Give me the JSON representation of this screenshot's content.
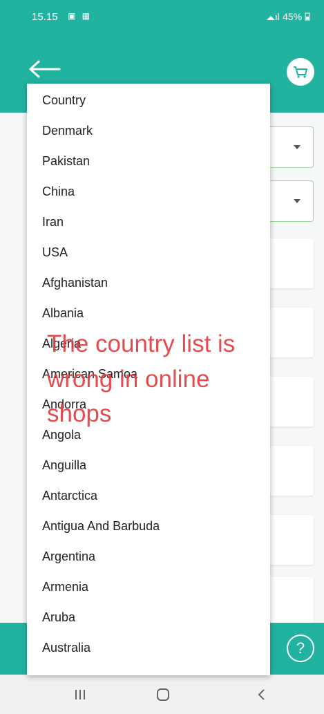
{
  "status_bar": {
    "time": "15.15",
    "notification_icons": "▣ ▦",
    "right": "45%"
  },
  "dropdown": {
    "items": [
      "Country",
      "Denmark",
      "Pakistan",
      "China",
      "Iran",
      "USA",
      "Afghanistan",
      "Albania",
      "Algeria",
      "American Samoa",
      "Andorra",
      "Angola",
      "Anguilla",
      "Antarctica",
      "Antigua And Barbuda",
      "Argentina",
      "Armenia",
      "Aruba",
      "Australia"
    ]
  },
  "overlay": {
    "lines": [
      "The country list is",
      "wrong in online",
      "shops"
    ]
  },
  "colors": {
    "primary": "#22b2a0",
    "overlay_text": "#e2393c",
    "field_border": "#9ed79a"
  },
  "icons": {
    "back": "arrow-left-icon",
    "cart": "shopping-cart-icon",
    "help": "help-icon",
    "help_glyph": "?",
    "nav_recent": "recent-apps-icon",
    "nav_home": "home-icon",
    "nav_back": "back-nav-icon"
  }
}
